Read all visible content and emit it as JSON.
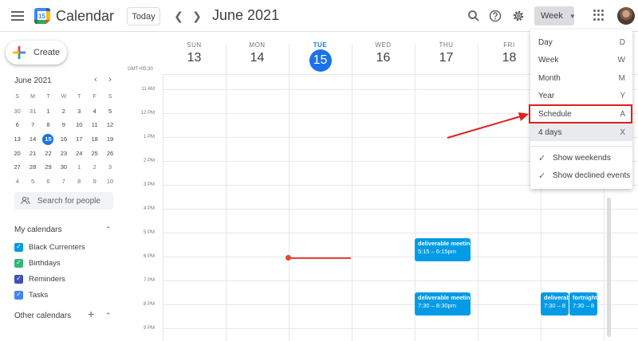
{
  "header": {
    "app_title": "Calendar",
    "logo_day": "15",
    "today_label": "Today",
    "month_title": "June 2021",
    "view_label": "Week"
  },
  "sidebar": {
    "create_label": "Create",
    "mini_calendar": {
      "title": "June 2021",
      "weekdays": [
        "S",
        "M",
        "T",
        "W",
        "T",
        "F",
        "S"
      ],
      "weeks": [
        [
          "30",
          "31",
          "1",
          "2",
          "3",
          "4",
          "5"
        ],
        [
          "6",
          "7",
          "8",
          "9",
          "10",
          "11",
          "12"
        ],
        [
          "13",
          "14",
          "15",
          "16",
          "17",
          "18",
          "19"
        ],
        [
          "20",
          "21",
          "22",
          "23",
          "24",
          "25",
          "26"
        ],
        [
          "27",
          "28",
          "29",
          "30",
          "1",
          "2",
          "3"
        ],
        [
          "4",
          "5",
          "6",
          "7",
          "8",
          "9",
          "10"
        ]
      ],
      "selected": "15"
    },
    "search_placeholder": "Search for people",
    "my_calendars_title": "My calendars",
    "my_calendars": [
      {
        "label": "Black Currenters",
        "color": "#039be5"
      },
      {
        "label": "Birthdays",
        "color": "#33b679"
      },
      {
        "label": "Reminders",
        "color": "#3f51b5"
      },
      {
        "label": "Tasks",
        "color": "#4285f4"
      }
    ],
    "other_calendars_title": "Other calendars"
  },
  "grid": {
    "timezone": "GMT+05:30",
    "days": [
      {
        "name": "SUN",
        "date": "13"
      },
      {
        "name": "MON",
        "date": "14"
      },
      {
        "name": "TUE",
        "date": "15",
        "today": true
      },
      {
        "name": "WED",
        "date": "16"
      },
      {
        "name": "THU",
        "date": "17"
      },
      {
        "name": "FRI",
        "date": "18"
      }
    ],
    "hours": [
      "11 AM",
      "12 PM",
      "1 PM",
      "2 PM",
      "3 PM",
      "4 PM",
      "5 PM",
      "6 PM",
      "7 PM",
      "8 PM",
      "9 PM"
    ],
    "events": [
      {
        "title": "deliverable meeting",
        "time": "5:15 – 6:15pm",
        "day": 4
      },
      {
        "title": "deliverable meeting",
        "time": "7:30 – 8:30pm",
        "day": 4
      },
      {
        "title": "deliverab",
        "time": "7:30 – 8",
        "day": 6
      },
      {
        "title": "fortnight",
        "time": "7:30 – 8",
        "day": 6
      }
    ]
  },
  "menu": {
    "items": [
      {
        "label": "Day",
        "shortcut": "D"
      },
      {
        "label": "Week",
        "shortcut": "W"
      },
      {
        "label": "Month",
        "shortcut": "M"
      },
      {
        "label": "Year",
        "shortcut": "Y"
      },
      {
        "label": "Schedule",
        "shortcut": "A"
      },
      {
        "label": "4 days",
        "shortcut": "X"
      }
    ],
    "options": [
      {
        "label": "Show weekends",
        "checked": true
      },
      {
        "label": "Show declined events",
        "checked": true
      }
    ],
    "highlight_color": "#e0201c"
  }
}
